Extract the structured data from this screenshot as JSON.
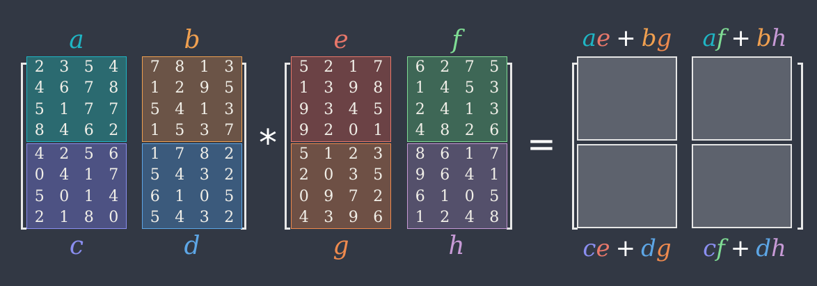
{
  "blocks": {
    "a": {
      "label": "a",
      "color": "#1fb5c4",
      "fill": "#2b6a70",
      "rows": [
        [
          "2",
          "3",
          "5",
          "4"
        ],
        [
          "4",
          "6",
          "7",
          "8"
        ],
        [
          "5",
          "1",
          "7",
          "7"
        ],
        [
          "8",
          "4",
          "6",
          "2"
        ]
      ]
    },
    "b": {
      "label": "b",
      "color": "#f0a050",
      "fill": "#6b5447",
      "rows": [
        [
          "7",
          "8",
          "1",
          "3"
        ],
        [
          "1",
          "2",
          "9",
          "5"
        ],
        [
          "5",
          "4",
          "1",
          "3"
        ],
        [
          "1",
          "5",
          "3",
          "7"
        ]
      ]
    },
    "c": {
      "label": "c",
      "color": "#8a8ef0",
      "fill": "#4d5283",
      "rows": [
        [
          "4",
          "2",
          "5",
          "6"
        ],
        [
          "0",
          "4",
          "1",
          "7"
        ],
        [
          "5",
          "0",
          "1",
          "4"
        ],
        [
          "2",
          "1",
          "8",
          "0"
        ]
      ]
    },
    "d": {
      "label": "d",
      "color": "#5da6e6",
      "fill": "#3b5a7c",
      "rows": [
        [
          "1",
          "7",
          "8",
          "2"
        ],
        [
          "5",
          "4",
          "3",
          "2"
        ],
        [
          "6",
          "1",
          "0",
          "5"
        ],
        [
          "5",
          "4",
          "3",
          "2"
        ]
      ]
    },
    "e": {
      "label": "e",
      "color": "#e8776a",
      "fill": "#6b4245",
      "rows": [
        [
          "5",
          "2",
          "1",
          "7"
        ],
        [
          "1",
          "3",
          "9",
          "8"
        ],
        [
          "9",
          "3",
          "4",
          "5"
        ],
        [
          "9",
          "2",
          "0",
          "1"
        ]
      ]
    },
    "f": {
      "label": "f",
      "color": "#7fdc94",
      "fill": "#3e6756",
      "rows": [
        [
          "6",
          "2",
          "7",
          "5"
        ],
        [
          "1",
          "4",
          "5",
          "3"
        ],
        [
          "2",
          "4",
          "1",
          "3"
        ],
        [
          "4",
          "8",
          "2",
          "6"
        ]
      ]
    },
    "g": {
      "label": "g",
      "color": "#ef8a4e",
      "fill": "#6e5045",
      "rows": [
        [
          "5",
          "1",
          "2",
          "3"
        ],
        [
          "2",
          "0",
          "3",
          "5"
        ],
        [
          "0",
          "9",
          "7",
          "2"
        ],
        [
          "4",
          "3",
          "9",
          "6"
        ]
      ]
    },
    "h": {
      "label": "h",
      "color": "#c79ad6",
      "fill": "#54506b",
      "rows": [
        [
          "8",
          "6",
          "1",
          "7"
        ],
        [
          "9",
          "6",
          "4",
          "1"
        ],
        [
          "6",
          "1",
          "0",
          "5"
        ],
        [
          "1",
          "2",
          "4",
          "8"
        ]
      ]
    }
  },
  "operators": {
    "multiply": "*",
    "equals": "="
  },
  "results": {
    "top_left": {
      "t1": "ae",
      "t2": "bg",
      "plus": "+"
    },
    "top_right": {
      "t1": "af",
      "t2": "bh",
      "plus": "+"
    },
    "bottom_left": {
      "t1": "ce",
      "t2": "dg",
      "plus": "+"
    },
    "bottom_right": {
      "t1": "cf",
      "t2": "dh",
      "plus": "+"
    }
  }
}
